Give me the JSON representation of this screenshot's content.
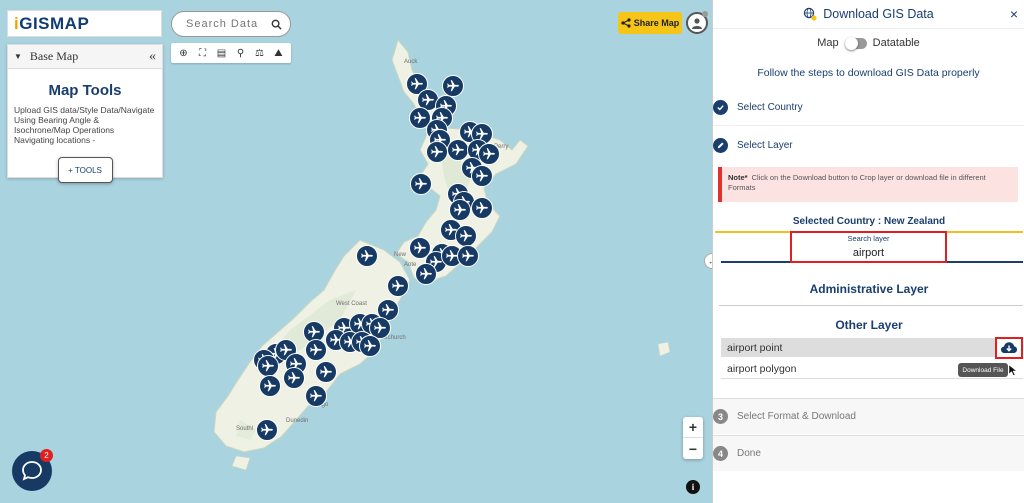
{
  "logo": {
    "text": "GISMAP",
    "prefix": "i"
  },
  "map_search": {
    "placeholder": "Search Data"
  },
  "map_toolbar": {
    "icons": [
      "locate-icon",
      "fullscreen-icon",
      "print-icon",
      "zoom-search-icon",
      "measure-icon",
      "layers-icon"
    ]
  },
  "left_panel": {
    "base_map_label": "Base Map",
    "title": "Map Tools",
    "description": "Upload GIS data/Style Data/Navigate Using Bearing Angle & Isochrone/Map Operations Navigating locations -",
    "tools_button": "+ TOOLS"
  },
  "share_button": "Share Map",
  "map_places": {
    "auckland": "Auck",
    "perry": "Perry",
    "new": "New",
    "aote": "Aote",
    "west_coast": "West Coast",
    "christchurch": "Christchurch",
    "otago": "Otago",
    "dunedin": "Dunedin",
    "southland": "Southl"
  },
  "zoom": {
    "in": "+",
    "out": "−"
  },
  "info": "i",
  "chat_badge": "2",
  "panel": {
    "title": "Download GIS Data",
    "close": "×",
    "toggle_left": "Map",
    "toggle_right": "Datatable",
    "intro": "Follow the steps to download GIS Data properly",
    "steps": {
      "step1": "Select Country",
      "step2": "Select Layer",
      "step3": "Select Format & Download",
      "step4": "Done",
      "step3_num": "3",
      "step4_num": "4"
    },
    "note_label": "Note*",
    "note_text": "Click on the Download button to Crop layer or download file in different Formats",
    "selected_country": "Selected Country : New Zealand",
    "search_layer_label": "Search layer",
    "search_layer_value": "airport",
    "administrative_layer": "Administrative Layer",
    "other_layer": "Other Layer",
    "layers": [
      "airport point",
      "airport polygon"
    ],
    "tooltip": "Download File"
  },
  "colors": {
    "primary": "#1a3e6e",
    "marker": "#163a63",
    "share": "#f5c518",
    "highlight": "#e02020",
    "note_bg": "#fde2e2",
    "water": "#a9d3df",
    "land": "#eef1e4"
  }
}
